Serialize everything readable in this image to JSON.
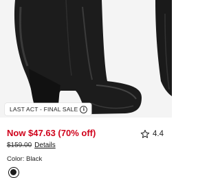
{
  "product": {
    "badge": "LAST ACT - FINAL SALE",
    "badge_icon": "info-icon",
    "price_now": "Now $47.63 (70% off)",
    "price_original": "$159.00",
    "details_link": "Details",
    "rating_value": "4.4",
    "rating_icon": "star-outline-icon",
    "color_text": "Color: Black",
    "swatch_color": "#1d1d1d",
    "accent_red": "#d0021b"
  }
}
